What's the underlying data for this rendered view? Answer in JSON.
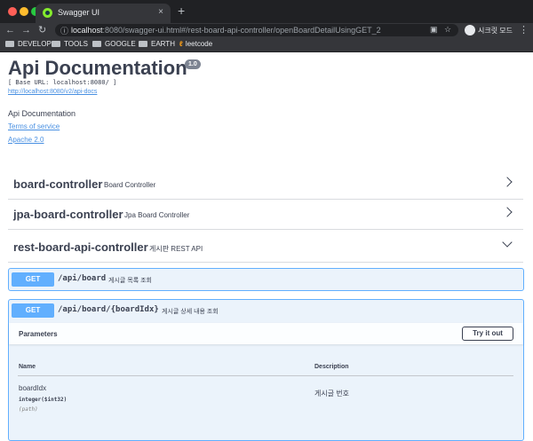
{
  "browser": {
    "tab_title": "Swagger UI",
    "tab_close": "×",
    "new_tab": "+",
    "url_host": "localhost",
    "url_path": ":8080/swagger-ui.html#/rest-board-api-controller/openBoardDetailUsingGET_2",
    "incognito_label": "시크릿 모드",
    "traffic_colors": [
      "#ff5f57",
      "#febc2e",
      "#28c840"
    ],
    "bookmarks": [
      "DEVELOP",
      "TOOLS",
      "GOOGLE",
      "EARTH",
      "leetcode"
    ]
  },
  "info": {
    "title": "Api Documentation",
    "version": "1.0",
    "base_url": "[ Base URL: localhost:8080/ ]",
    "docs_url": "http://localhost:8080/v2/api-docs",
    "description": "Api Documentation",
    "terms": "Terms of service",
    "license": "Apache 2.0"
  },
  "controllers": [
    {
      "name": "board-controller",
      "description": "Board Controller",
      "expanded": false
    },
    {
      "name": "jpa-board-controller",
      "description": "Jpa Board Controller",
      "expanded": false
    },
    {
      "name": "rest-board-api-controller",
      "description": "게시판 REST API",
      "expanded": true
    }
  ],
  "operations": [
    {
      "method": "GET",
      "path": "/api/board",
      "summary": "게시글 목록 조회"
    },
    {
      "method": "GET",
      "path": "/api/board/{boardIdx}",
      "summary": "게시글 상세 내용 조회"
    }
  ],
  "parameters": {
    "title": "Parameters",
    "try_button": "Try it out",
    "col_name": "Name",
    "col_description": "Description",
    "rows": [
      {
        "name": "boardIdx",
        "type": "integer($int32)",
        "in": "(path)",
        "description": "게시글 번호"
      }
    ]
  },
  "colors": {
    "get_accent": "#61affe",
    "get_bg": "#ebf3fb",
    "text": "#3b4151",
    "link": "#4990e2"
  }
}
